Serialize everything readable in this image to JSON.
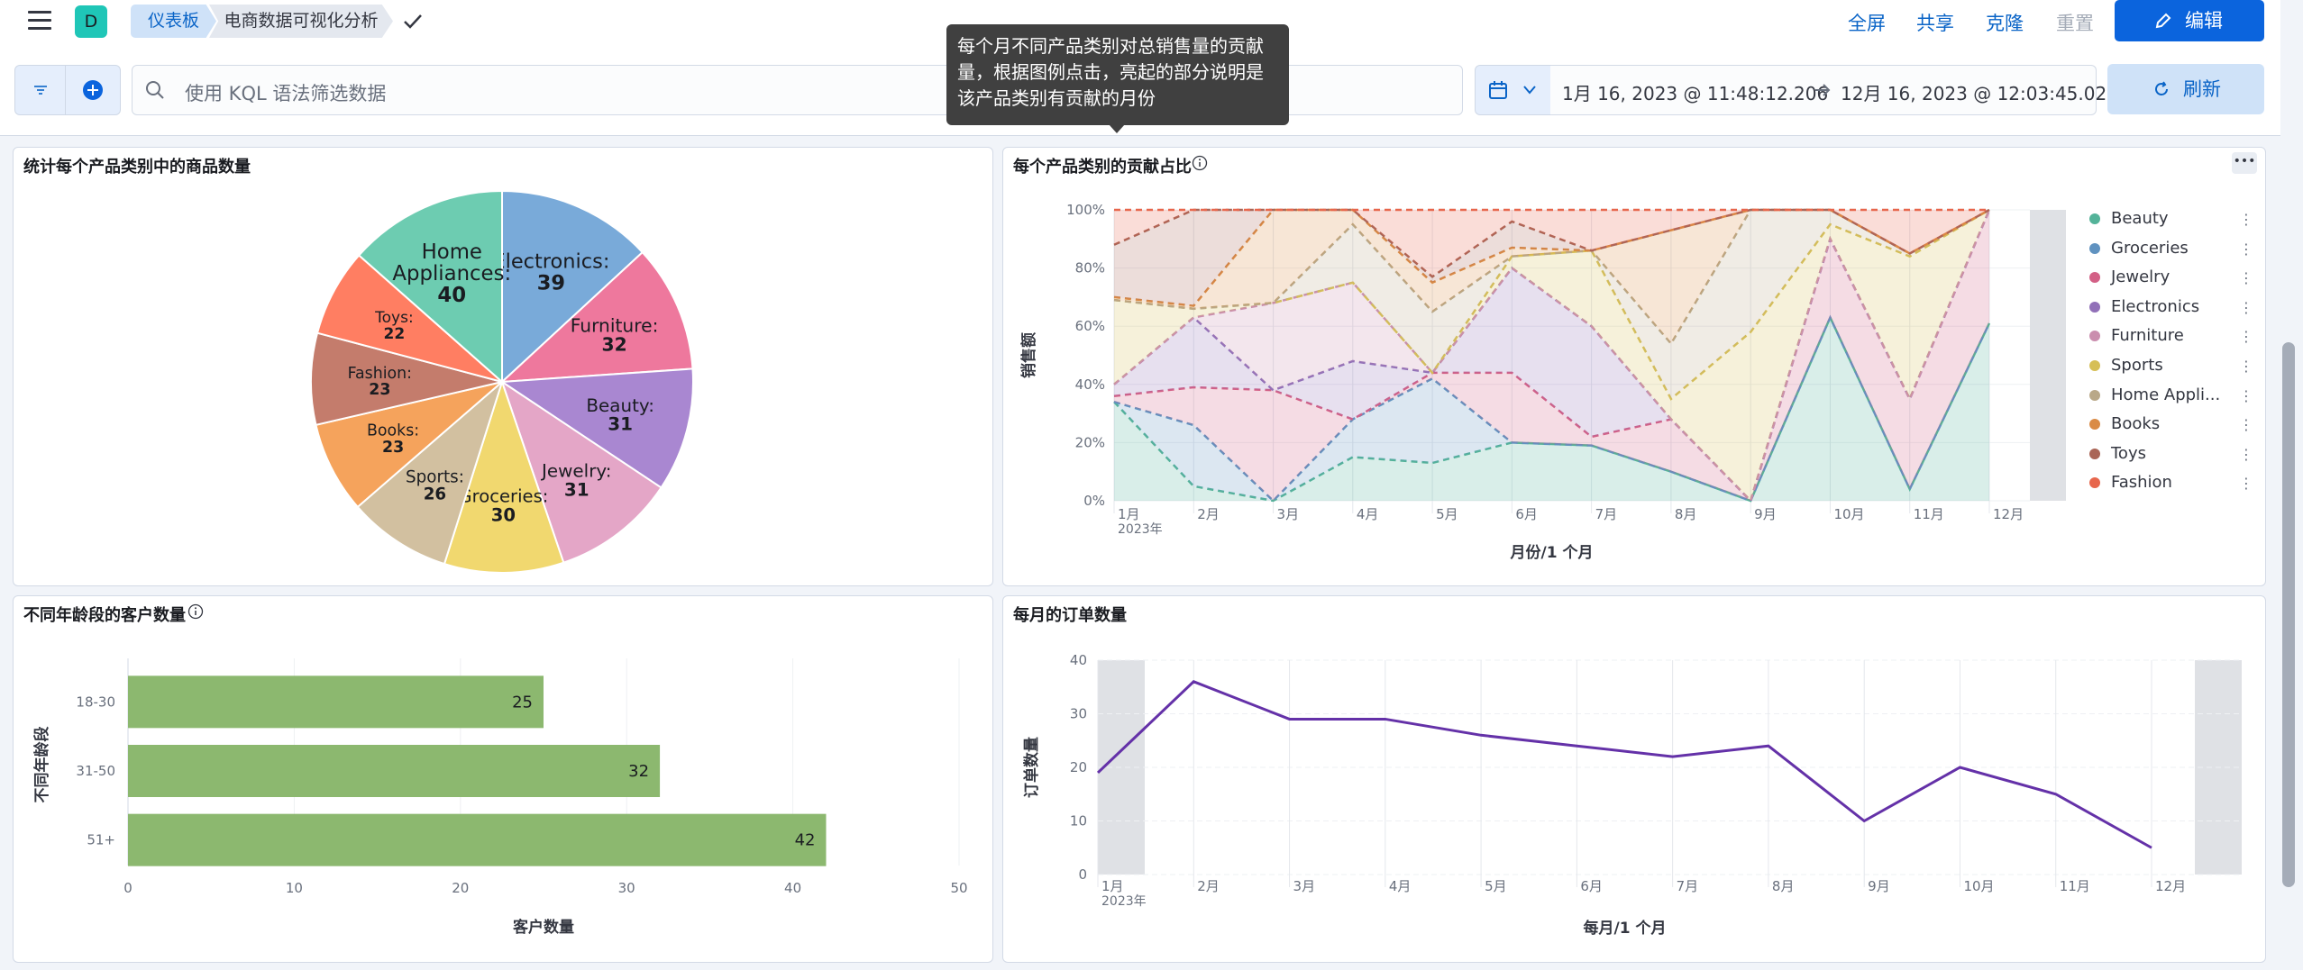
{
  "header": {
    "avatar_letter": "D",
    "breadcrumb_root": "仪表板",
    "breadcrumb_current": "电商数据可视化分析",
    "links": {
      "fullscreen": "全屏",
      "share": "共享",
      "clone": "克隆",
      "reset": "重置"
    },
    "edit_label": "编辑"
  },
  "query": {
    "placeholder": "使用 KQL 语法筛选数据",
    "date_start": "1月 16, 2023 @ 11:48:12.206",
    "date_end": "12月 16, 2023 @ 12:03:45.020",
    "refresh_label": "刷新"
  },
  "tooltip": "每个月不同产品类别对总销售量的贡献量，根据图例点击，亮起的部分说明是该产品类别有贡献的月份",
  "panels": {
    "pie_title": "统计每个产品类别中的商品数量",
    "area_title": "每个产品类别的贡献占比",
    "bar_title": "不同年龄段的客户数量",
    "line_title": "每月的订单数量"
  },
  "colors": {
    "accent": "#0b64dd",
    "Beauty": "#54b399",
    "Groceries": "#6092c0",
    "Jewelry": "#d36086",
    "Electronics": "#9170b8",
    "Furniture": "#ca8eae",
    "Sports": "#d6bf57",
    "Home Appliances": "#b9a888",
    "Books": "#da8b45",
    "Toys": "#aa6556",
    "Fashion": "#e7664c",
    "bar": "#8cb86f",
    "line": "#6431a8"
  },
  "chart_data": [
    {
      "type": "pie",
      "title": "统计每个产品类别中的商品数量",
      "slices": [
        {
          "label": "Electronics",
          "value": 39,
          "color": "#79aad9"
        },
        {
          "label": "Furniture",
          "value": 32,
          "color": "#ee789d"
        },
        {
          "label": "Beauty",
          "value": 31,
          "color": "#a987d1"
        },
        {
          "label": "Jewelry",
          "value": 31,
          "color": "#e4a6c7"
        },
        {
          "label": "Groceries",
          "value": 30,
          "color": "#f1d86f"
        },
        {
          "label": "Sports",
          "value": 26,
          "color": "#d2c0a0"
        },
        {
          "label": "Books",
          "value": 23,
          "color": "#f5a35c"
        },
        {
          "label": "Fashion",
          "value": 23,
          "color": "#c47c6c"
        },
        {
          "label": "Toys",
          "value": 22,
          "color": "#ff7e62"
        },
        {
          "label": "Home Appliances",
          "value": 40,
          "color": "#6dccb1"
        }
      ]
    },
    {
      "type": "area",
      "title": "每个产品类别的贡献占比",
      "xlabel": "月份/1 个月",
      "ylabel": "销售额",
      "categories": [
        "1月",
        "2月",
        "3月",
        "4月",
        "5月",
        "6月",
        "7月",
        "8月",
        "9月",
        "10月",
        "11月",
        "12月"
      ],
      "year_label": "2023年",
      "yticks": [
        "0%",
        "20%",
        "40%",
        "60%",
        "80%",
        "100%"
      ],
      "ylim": [
        0,
        100
      ],
      "series": [
        {
          "name": "Beauty",
          "values": [
            34,
            5,
            0,
            15,
            13,
            20,
            19,
            10,
            0,
            63,
            4,
            61
          ]
        },
        {
          "name": "Groceries",
          "values": [
            34,
            26,
            0,
            28,
            42,
            20,
            19,
            10,
            0,
            63,
            4,
            61
          ]
        },
        {
          "name": "Jewelry",
          "values": [
            36,
            39,
            38,
            28,
            44,
            44,
            22,
            28,
            0,
            90,
            35,
            100
          ]
        },
        {
          "name": "Electronics",
          "values": [
            40,
            63,
            38,
            48,
            44,
            80,
            60,
            28,
            0,
            90,
            35,
            100
          ]
        },
        {
          "name": "Furniture",
          "values": [
            40,
            63,
            68,
            75,
            44,
            80,
            60,
            28,
            0,
            90,
            35,
            100
          ]
        },
        {
          "name": "Sports",
          "values": [
            69,
            66,
            68,
            75,
            44,
            84,
            86,
            35,
            58,
            95,
            84,
            100
          ]
        },
        {
          "name": "Home Appliances",
          "values": [
            69,
            66,
            68,
            95,
            65,
            84,
            86,
            54,
            100,
            100,
            85,
            100
          ]
        },
        {
          "name": "Books",
          "values": [
            70,
            67,
            100,
            100,
            75,
            87,
            86,
            93,
            100,
            100,
            85,
            100
          ]
        },
        {
          "name": "Toys",
          "values": [
            88,
            100,
            100,
            100,
            77,
            96,
            86,
            93,
            100,
            100,
            85,
            100
          ]
        },
        {
          "name": "Fashion",
          "values": [
            100,
            100,
            100,
            100,
            100,
            100,
            100,
            100,
            100,
            100,
            100,
            100
          ]
        }
      ]
    },
    {
      "type": "bar",
      "title": "不同年龄段的客户数量",
      "xlabel": "客户数量",
      "ylabel": "不同年龄段",
      "categories": [
        "18-30",
        "31-50",
        "51+"
      ],
      "values": [
        25,
        32,
        42
      ],
      "xticks": [
        0,
        10,
        20,
        30,
        40,
        50
      ],
      "xlim": [
        0,
        50
      ]
    },
    {
      "type": "line",
      "title": "每月的订单数量",
      "xlabel": "每月/1 个月",
      "ylabel": "订单数量",
      "categories": [
        "1月",
        "2月",
        "3月",
        "4月",
        "5月",
        "6月",
        "7月",
        "8月",
        "9月",
        "10月",
        "11月",
        "12月"
      ],
      "year_label": "2023年",
      "values": [
        19,
        36,
        29,
        29,
        26,
        24,
        22,
        24,
        10,
        20,
        15,
        5
      ],
      "yticks": [
        0,
        10,
        20,
        30,
        40
      ],
      "ylim": [
        0,
        40
      ]
    }
  ]
}
